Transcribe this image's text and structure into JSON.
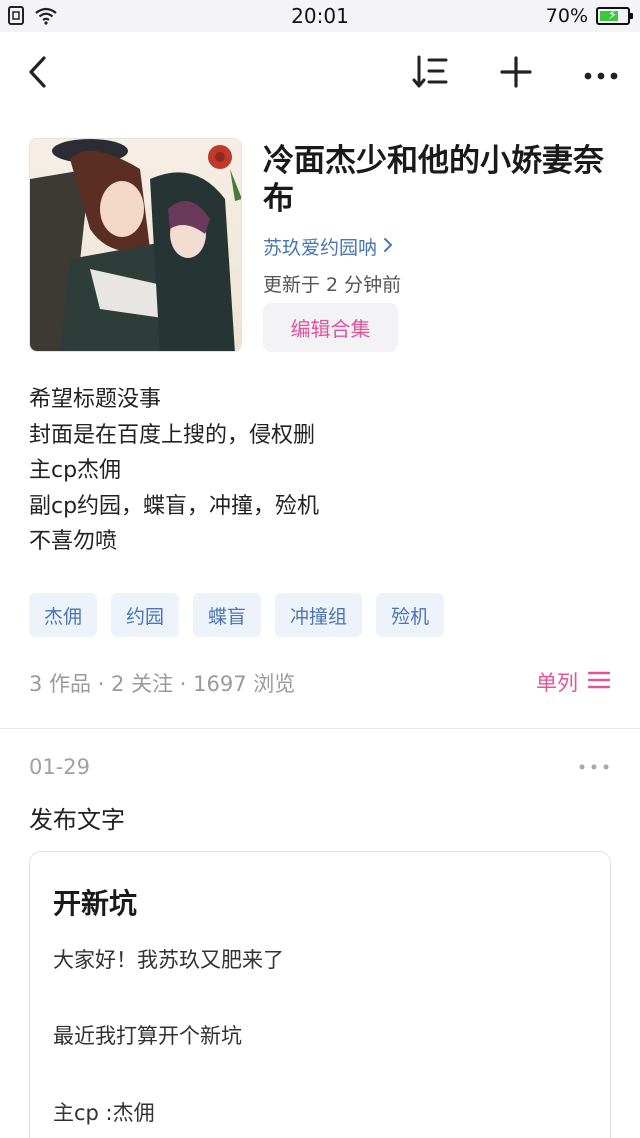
{
  "status_bar": {
    "time": "20:01",
    "battery_percent": "70%",
    "icons": [
      "sim-icon",
      "wifi-icon",
      "battery-icon"
    ]
  },
  "nav": {
    "icons": [
      "back-icon",
      "sort-icon",
      "add-icon",
      "more-icon"
    ]
  },
  "collection": {
    "title": "冷面杰少和他的小娇妻奈布",
    "author": "苏玖爱约园呐",
    "updated": "更新于 2 分钟前",
    "edit_label": "编辑合集",
    "description": [
      "希望标题没事",
      "封面是在百度上搜的，侵权删",
      "主cp杰佣",
      "副cp约园，蝶盲，冲撞，殓机",
      "不喜勿喷"
    ],
    "tags": [
      "杰佣",
      "约园",
      "蝶盲",
      "冲撞组",
      "殓机"
    ],
    "stats": "3 作品 · 2 关注 · 1697 浏览",
    "layout_label": "单列"
  },
  "post": {
    "date": "01-29",
    "type_label": "发布文字",
    "card_title": "开新坑",
    "card_lines": [
      "大家好！我苏玖又肥来了",
      "最近我打算开个新坑",
      "主cp :杰佣"
    ]
  },
  "colors": {
    "accent_pink": "#e0559b",
    "link_blue": "#4a76b5",
    "tag_bg": "#eef3fb"
  }
}
